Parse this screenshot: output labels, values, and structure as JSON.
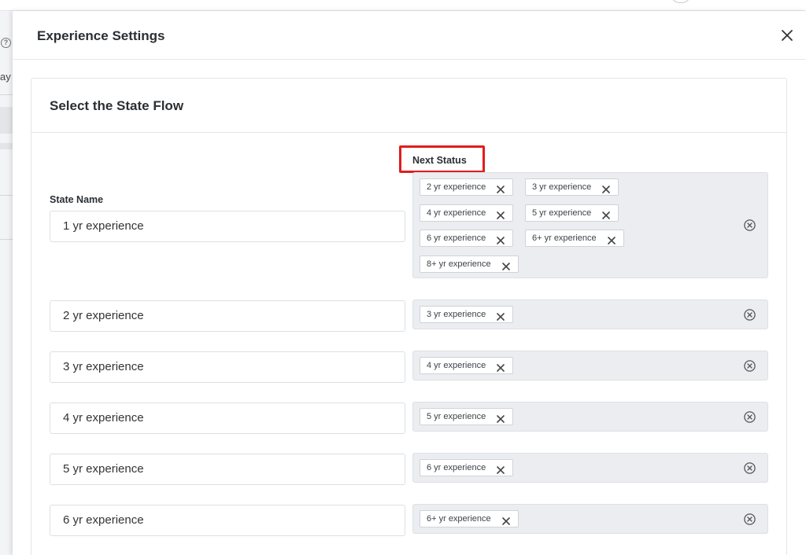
{
  "drawer": {
    "title": "Experience Settings"
  },
  "card": {
    "title": "Select the State Flow",
    "next_status_label": "Next Status",
    "state_name_label": "State Name"
  },
  "rows": [
    {
      "state": "1 yr experience",
      "next": [
        "2 yr experience",
        "3 yr experience",
        "4 yr experience",
        "5 yr experience",
        "6 yr experience",
        "6+ yr experience",
        "8+ yr experience"
      ]
    },
    {
      "state": "2 yr experience",
      "next": [
        "3 yr experience"
      ]
    },
    {
      "state": "3 yr experience",
      "next": [
        "4 yr experience"
      ]
    },
    {
      "state": "4 yr experience",
      "next": [
        "5 yr experience"
      ]
    },
    {
      "state": "5 yr experience",
      "next": [
        "6 yr experience"
      ]
    },
    {
      "state": "6 yr experience",
      "next": [
        "6+ yr experience"
      ]
    }
  ],
  "colors": {
    "highlight": "#e11d1d",
    "tag_area": "#ebedf0"
  }
}
